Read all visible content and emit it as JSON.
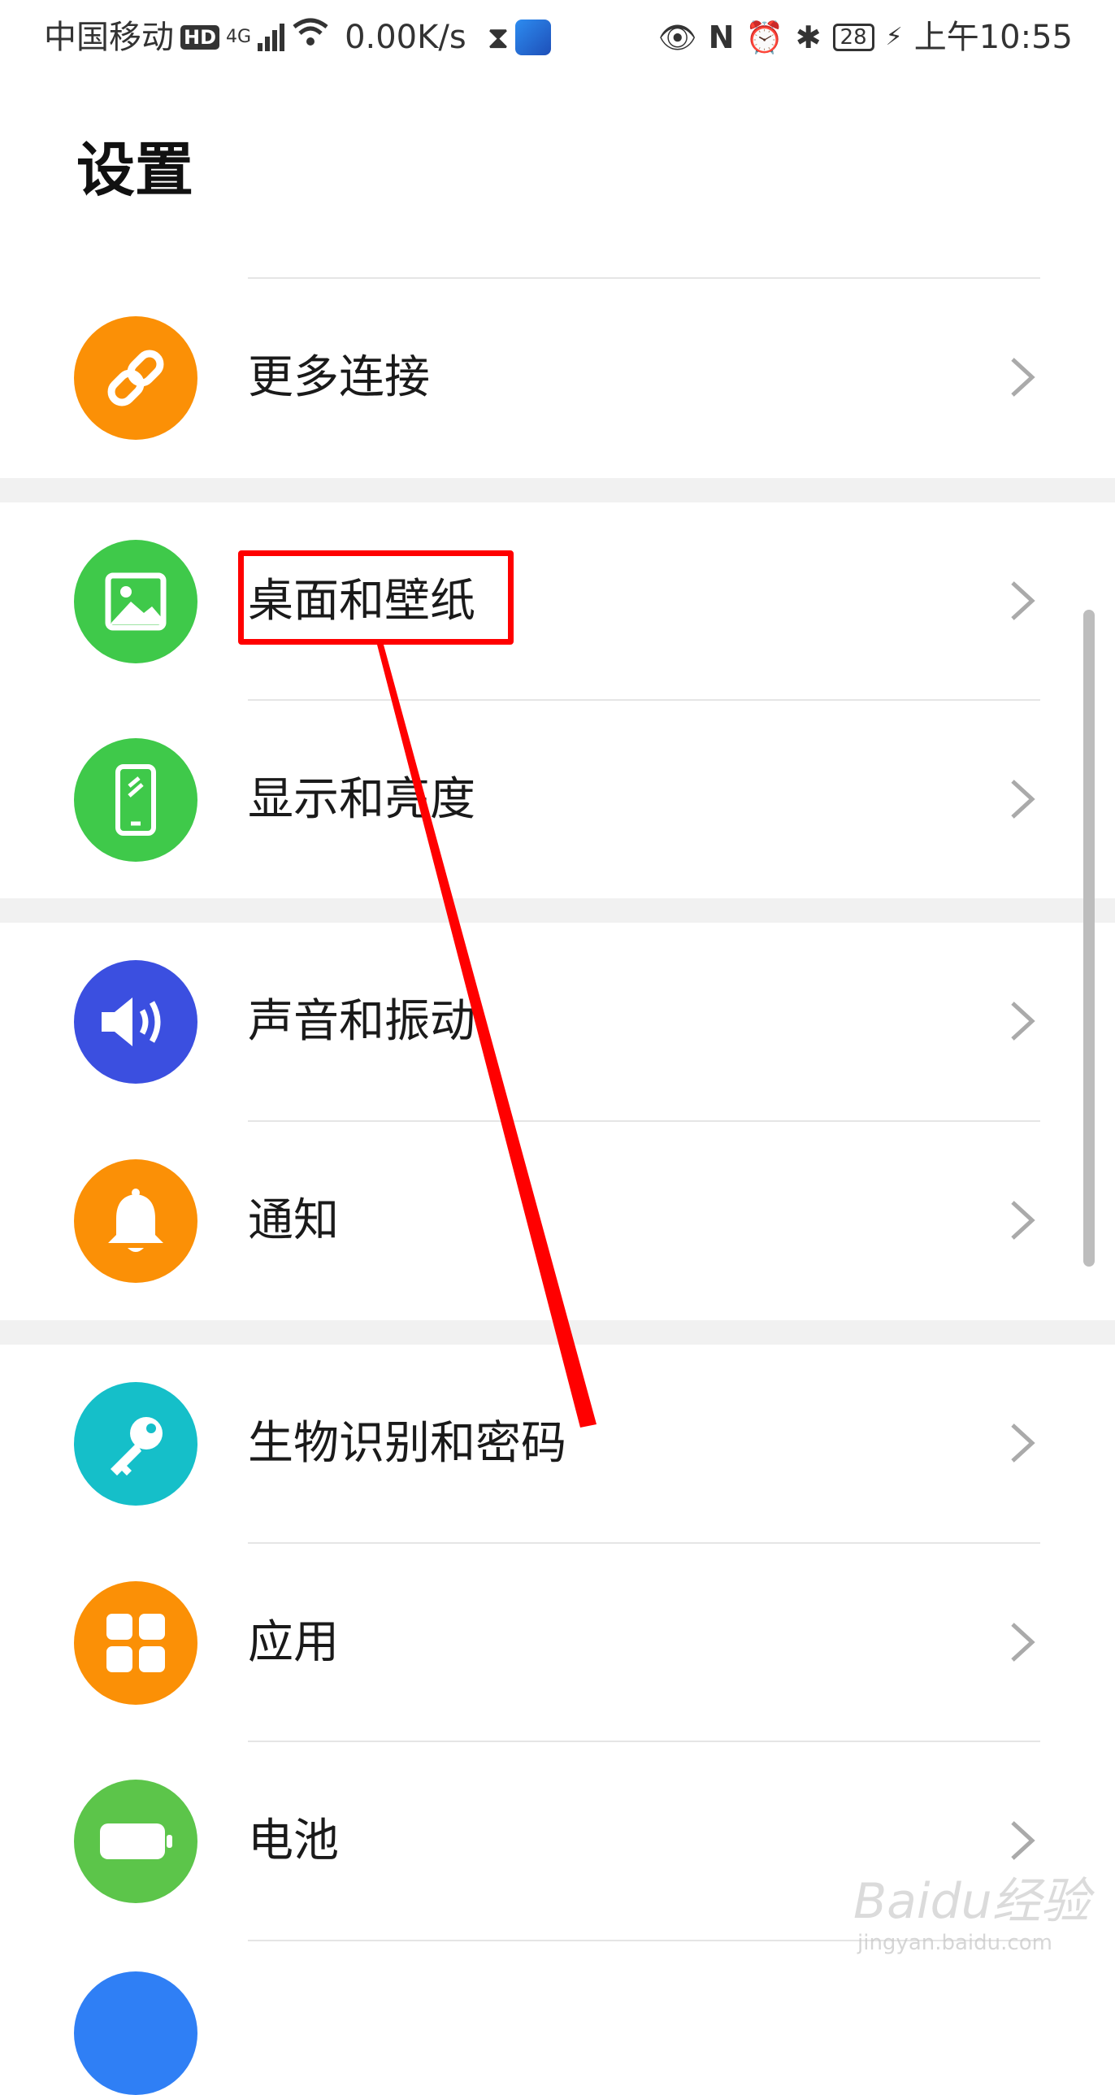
{
  "status_bar": {
    "carrier": "中国移动",
    "hd": "HD",
    "network": "4G",
    "speed": "0.00K/s",
    "battery": "28",
    "time": "上午10:55"
  },
  "page": {
    "title": "设置"
  },
  "items": [
    {
      "label": "更多连接",
      "icon": "link-icon",
      "color": "#fb9006"
    },
    {
      "label": "桌面和壁纸",
      "icon": "image-icon",
      "color": "#3fc94a"
    },
    {
      "label": "显示和亮度",
      "icon": "phone-display-icon",
      "color": "#3fc94a"
    },
    {
      "label": "声音和振动",
      "icon": "speaker-icon",
      "color": "#3b4fe0"
    },
    {
      "label": "通知",
      "icon": "bell-icon",
      "color": "#fb9006"
    },
    {
      "label": "生物识别和密码",
      "icon": "key-icon",
      "color": "#15bfc9"
    },
    {
      "label": "应用",
      "icon": "grid-icon",
      "color": "#fb9006"
    },
    {
      "label": "电池",
      "icon": "battery-icon",
      "color": "#5cc54a"
    }
  ],
  "watermark": {
    "text": "Baidu经验",
    "sub": "jingyan.baidu.com"
  },
  "annotation_color": "#ff0000"
}
